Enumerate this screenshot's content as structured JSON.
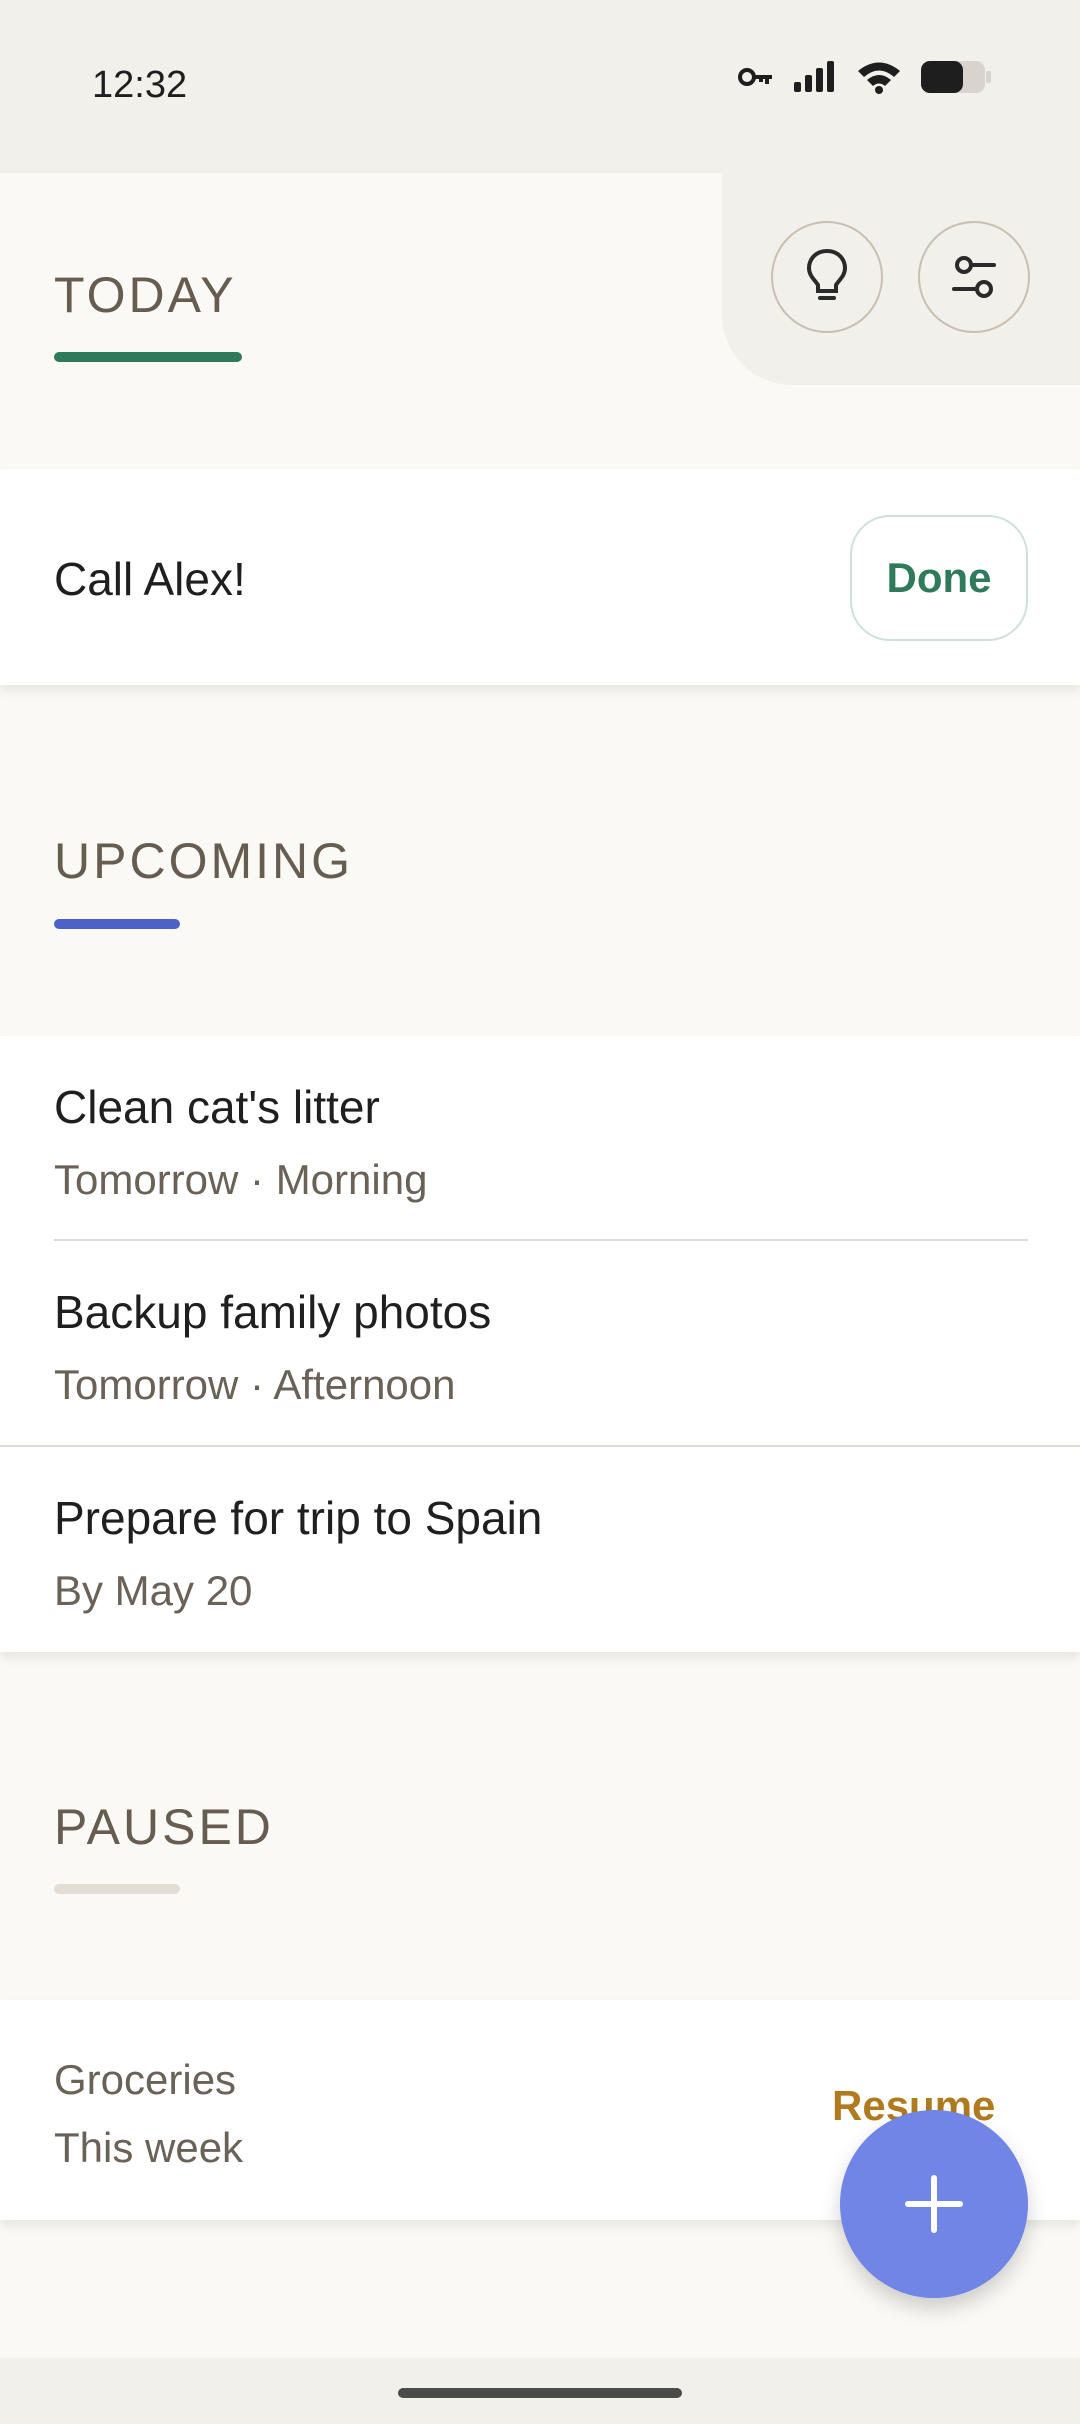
{
  "status_bar": {
    "time": "12:32",
    "icons": [
      "vpn-key-icon",
      "signal-icon",
      "wifi-icon",
      "battery-icon"
    ]
  },
  "header": {
    "buttons": [
      {
        "icon": "lightbulb-icon"
      },
      {
        "icon": "filter-sliders-icon"
      }
    ]
  },
  "sections": {
    "today": {
      "title": "TODAY",
      "accent": "#2f7a5a",
      "items": [
        {
          "title": "Call Alex!",
          "action": "Done"
        }
      ]
    },
    "upcoming": {
      "title": "UPCOMING",
      "accent": "#4d62c9",
      "items": [
        {
          "title": "Clean cat's litter",
          "subtitle": "Tomorrow · Morning"
        },
        {
          "title": "Backup family photos",
          "subtitle": "Tomorrow · Afternoon"
        },
        {
          "title": "Prepare for trip to Spain",
          "subtitle": "By May 20"
        }
      ]
    },
    "paused": {
      "title": "PAUSED",
      "accent": "#e3ddd4",
      "items": [
        {
          "title": "Groceries",
          "subtitle": "This week",
          "action": "Resume"
        }
      ]
    }
  },
  "fab": {
    "icon": "plus-icon",
    "color": "#7085e5"
  }
}
